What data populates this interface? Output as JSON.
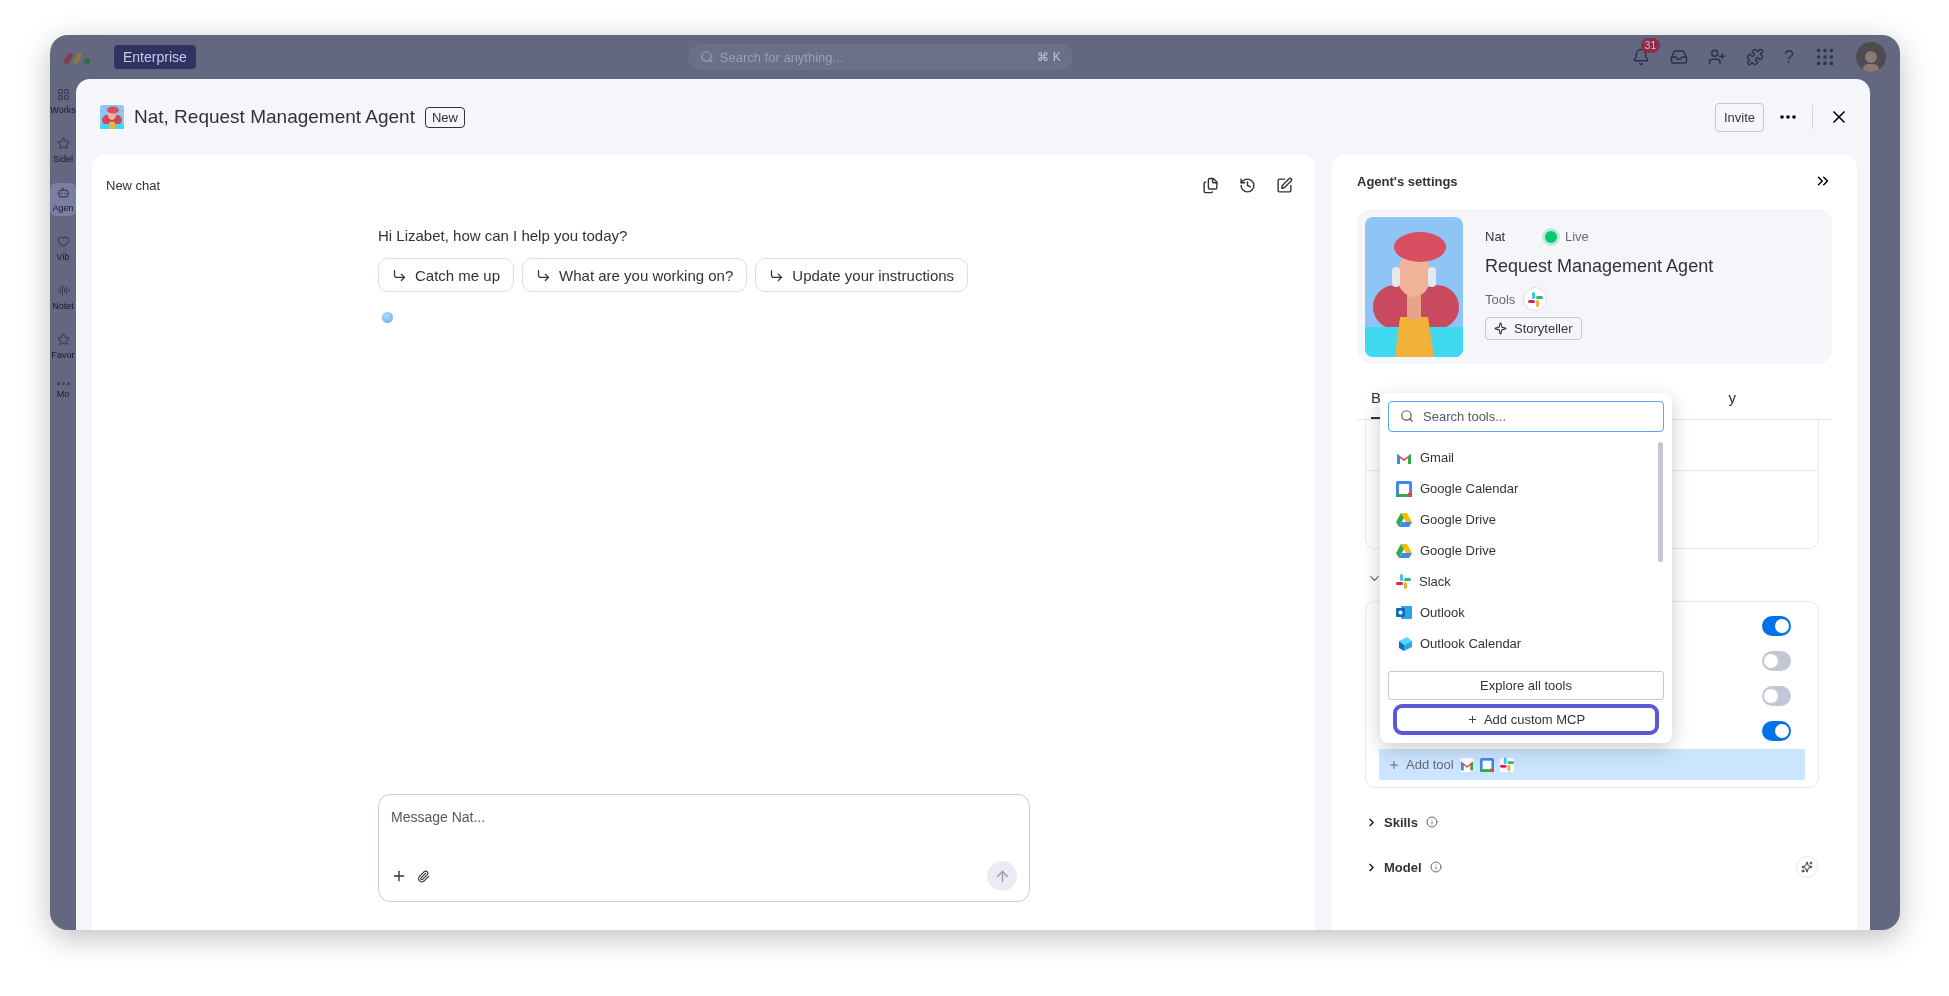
{
  "topbar": {
    "plan": "Enterprise",
    "search": {
      "placeholder": "Search for anything..."
    },
    "shortcut": "⌘ K",
    "notifications": "31",
    "help": "?"
  },
  "sidebar": {
    "items": [
      {
        "label": "Works",
        "selected": false
      },
      {
        "label": "Sidel",
        "selected": false
      },
      {
        "label": "Agen",
        "selected": true
      },
      {
        "label": "Vib",
        "selected": false
      },
      {
        "label": "Notet",
        "selected": false
      },
      {
        "label": "Favor",
        "selected": false
      },
      {
        "label": "Mo",
        "selected": false
      }
    ]
  },
  "modal": {
    "title": "Nat, Request Management Agent",
    "badge": "New",
    "invite": "Invite"
  },
  "chat": {
    "title": "New chat",
    "greeting": "Hi Lizabet, how can I help you today?",
    "suggestions": [
      "Catch me up",
      "What are you working on?",
      "Update your instructions"
    ],
    "message": {
      "placeholder": "Message Nat..."
    }
  },
  "settings": {
    "title": "Agent's settings",
    "agent": {
      "name": "Nat",
      "status": "Live",
      "role": "Request Management Agent",
      "tools_label": "Tools",
      "persona": "Storyteller"
    },
    "tabs": [
      {
        "label": "B",
        "selected": true
      },
      {
        "label": "y",
        "selected": false
      }
    ],
    "toggles": [
      {
        "on": true
      },
      {
        "on": false
      },
      {
        "on": false
      },
      {
        "on": true
      }
    ],
    "add_tool": "Add tool",
    "sections": [
      {
        "label": "Skills",
        "expanded": false
      },
      {
        "label": "Model",
        "expanded": false
      }
    ]
  },
  "tool_menu": {
    "search": {
      "placeholder": "Search tools..."
    },
    "items": [
      {
        "label": "Gmail",
        "kind": "gmail"
      },
      {
        "label": "Google Calendar",
        "kind": "gcal"
      },
      {
        "label": "Google Drive",
        "kind": "gdrive"
      },
      {
        "label": "Google Drive",
        "kind": "gdrive"
      },
      {
        "label": "Slack",
        "kind": "slack"
      },
      {
        "label": "Outlook",
        "kind": "outlook"
      },
      {
        "label": "Outlook Calendar",
        "kind": "outlookcal"
      }
    ],
    "explore": "Explore all tools",
    "custom": {
      "label": "Add custom MCP",
      "focused": true
    }
  }
}
